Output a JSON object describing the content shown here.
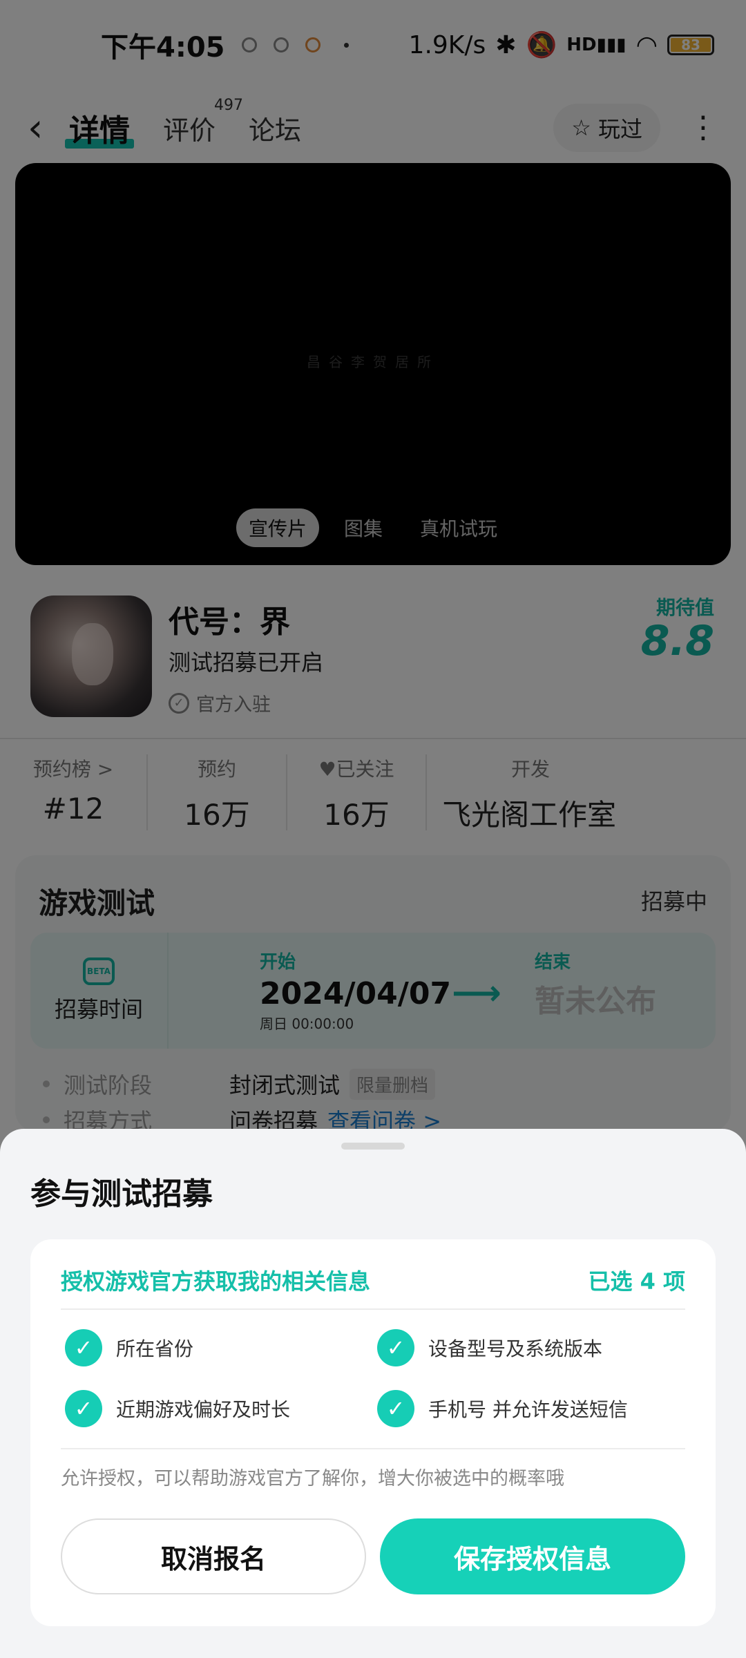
{
  "status_bar": {
    "time": "下午4:05",
    "net_speed": "1.9K/s",
    "signal": "HD",
    "battery": "83"
  },
  "nav": {
    "tabs": [
      {
        "label": "详情",
        "active": true
      },
      {
        "label": "评价",
        "badge": "497"
      },
      {
        "label": "论坛"
      }
    ],
    "played_label": "玩过"
  },
  "media": {
    "watermark": "昌谷李贺居所",
    "tabs": [
      "宣传片",
      "图集",
      "真机试玩"
    ]
  },
  "game": {
    "title": "代号：界",
    "subtitle": "测试招募已开启",
    "verified": "官方入驻",
    "expect_label": "期待值",
    "expect_value": "8.8"
  },
  "stats": [
    {
      "label": "预约榜 >",
      "value": "#12"
    },
    {
      "label": "预约",
      "value": "16万"
    },
    {
      "label": "已关注",
      "value": "16万"
    },
    {
      "label": "开发",
      "value": "飞光阁工作室"
    }
  ],
  "test": {
    "title": "游戏测试",
    "status": "招募中",
    "time_label": "招募时间",
    "beta": "BETA",
    "start_caption": "开始",
    "start_date": "2024/04/07",
    "start_time": "周日  00:00:00",
    "end_caption": "结束",
    "end_date": "暂未公布",
    "rows": [
      {
        "key": "测试阶段",
        "value": "封闭式测试",
        "tag": "限量删档"
      },
      {
        "key": "招募方式",
        "value": "问卷招募",
        "link": "查看问卷 >"
      }
    ]
  },
  "sheet": {
    "title": "参与测试招募",
    "auth_title": "授权游戏官方获取我的相关信息",
    "selected": "已选 4 项",
    "items": [
      "所在省份",
      "设备型号及系统版本",
      "近期游戏偏好及时长",
      "手机号 并允许发送短信"
    ],
    "hint": "允许授权，可以帮助游戏官方了解你，增大你被选中的概率哦",
    "cancel": "取消报名",
    "save": "保存授权信息"
  },
  "colors": {
    "accent": "#16d1b8",
    "accent_text": "#15bfa9",
    "overlay": "rgba(0,0,0,0.5)"
  }
}
